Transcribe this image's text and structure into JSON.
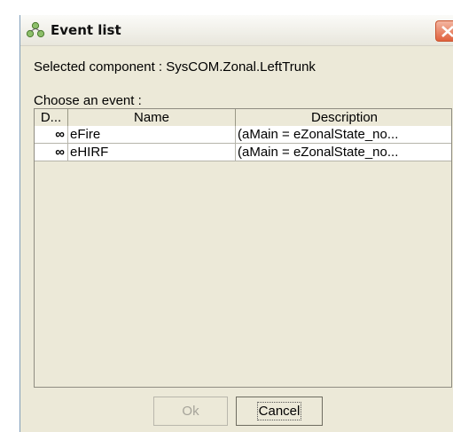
{
  "window": {
    "title": "Event list",
    "close_icon": "close-icon"
  },
  "selected_component": {
    "label": "Selected component :",
    "value": "SysCOM.Zonal.LeftTrunk"
  },
  "choose_label": "Choose an event :",
  "table": {
    "columns": [
      "D...",
      "Name",
      "Description"
    ],
    "rows": [
      {
        "d": "∞",
        "name": "eFire",
        "description": "(aMain = eZonalState_no..."
      },
      {
        "d": "∞",
        "name": "eHIRF",
        "description": "(aMain = eZonalState_no..."
      }
    ]
  },
  "buttons": {
    "ok_label": "Ok",
    "cancel_label": "Cancel"
  },
  "colors": {
    "dialog_bg": "#ece9d8",
    "close_button": "#e0613d"
  }
}
